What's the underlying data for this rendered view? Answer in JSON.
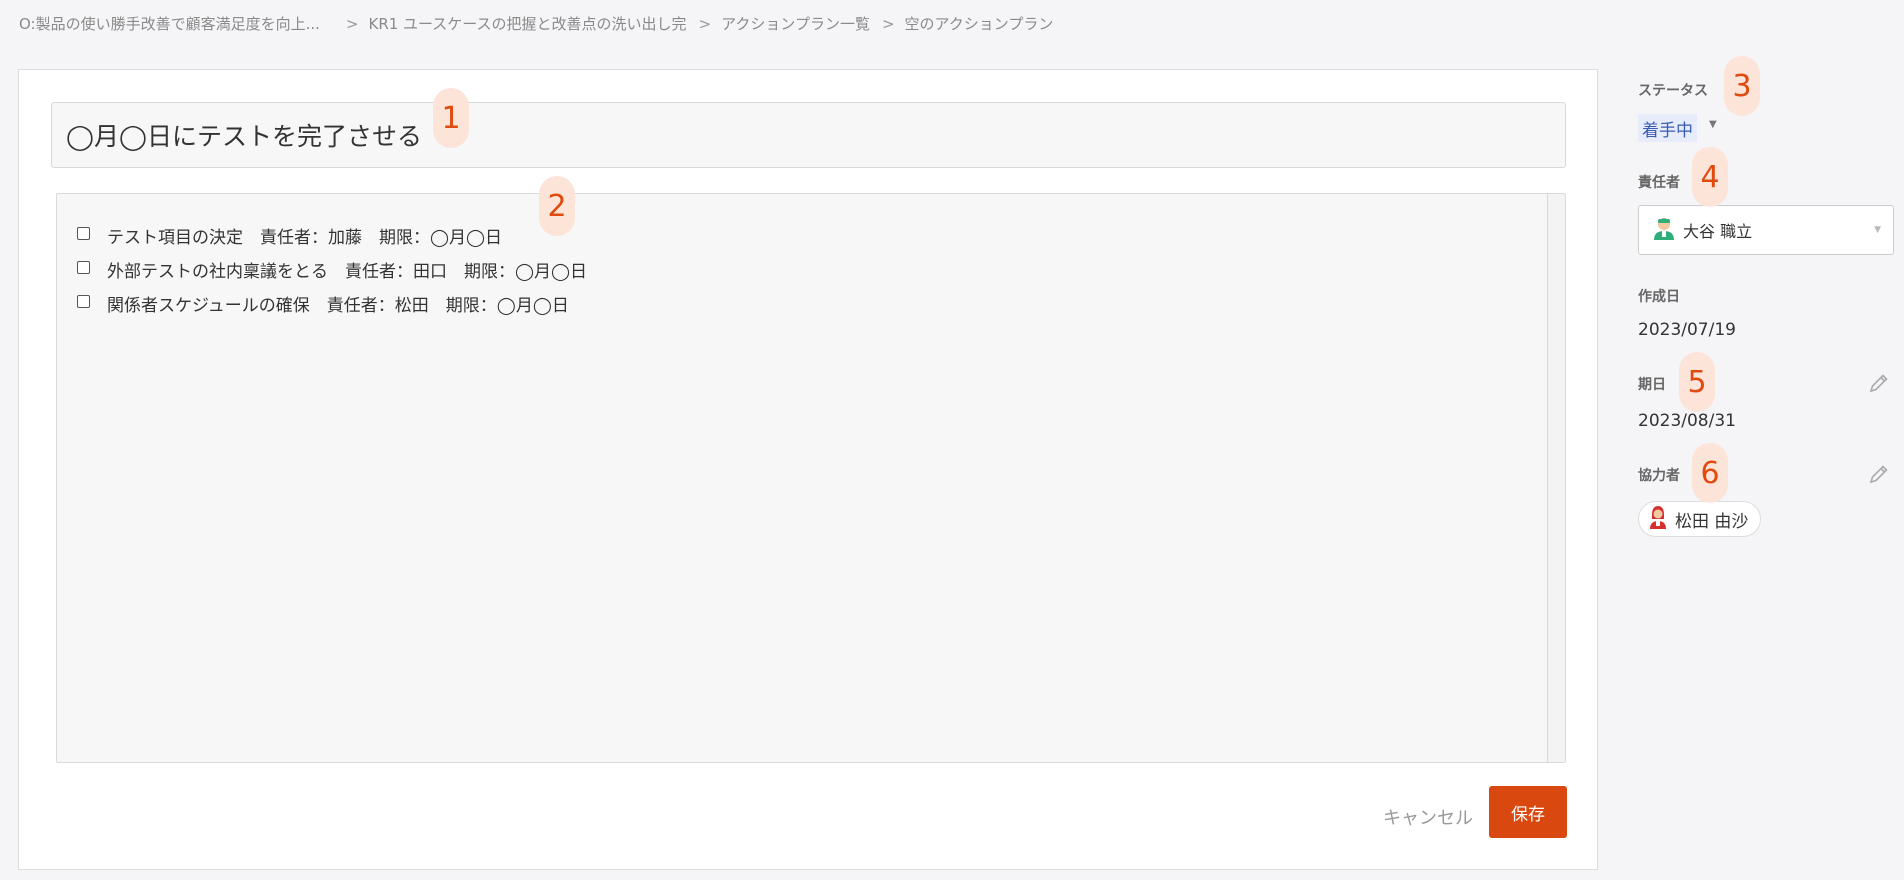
{
  "breadcrumb": {
    "items": [
      "O:製品の使い勝手改善で顧客満足度を向上...",
      "KR1 ユースケースの把握と改善点の洗い出し完",
      "アクションプラン一覧",
      "空のアクションプラン"
    ],
    "separator": ">"
  },
  "editor": {
    "title": "◯月◯日にテストを完了させる",
    "checklist": [
      {
        "checked": false,
        "text": "テスト項目の決定　責任者：加藤　期限：◯月◯日"
      },
      {
        "checked": false,
        "text": "外部テストの社内稟議をとる　責任者：田口　期限：◯月◯日"
      },
      {
        "checked": false,
        "text": "関係者スケジュールの確保　責任者：松田　期限：◯月◯日"
      }
    ]
  },
  "actions": {
    "cancel_label": "キャンセル",
    "save_label": "保存"
  },
  "sidebar": {
    "status_label": "ステータス",
    "status_value": "着手中",
    "assignee_label": "責任者",
    "assignee_name": "大谷 職立",
    "created_label": "作成日",
    "created_value": "2023/07/19",
    "due_label": "期日",
    "due_value": "2023/08/31",
    "collaborators_label": "協力者",
    "collaborators": [
      "松田 由沙"
    ]
  },
  "markers": [
    "1",
    "2",
    "3",
    "4",
    "5",
    "6"
  ],
  "colors": {
    "accent": "#d9480f",
    "marker_bg": "#fde4d9",
    "marker_text": "#e04a0f",
    "status_bg": "#e6ecfa",
    "status_text": "#3a5bb5"
  }
}
